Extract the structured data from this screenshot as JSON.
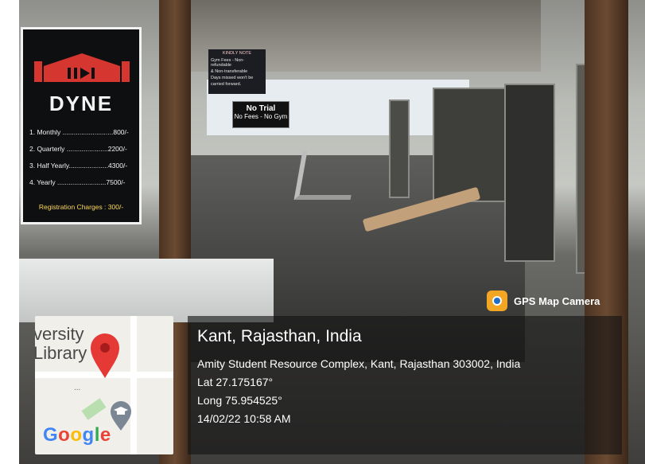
{
  "poster": {
    "brand": "DYNE",
    "plans": [
      "1. Monthly ...........................800/-",
      "2. Quarterly ......................2200/-",
      "3. Half Yearly.....................4300/-",
      "4. Yearly ..........................7500/-"
    ],
    "registration": "Registration Charges : 300/-"
  },
  "signs": {
    "kindly_title": "KINDLY NOTE",
    "kindly_line1": "Gym Fees - Non-refundable",
    "kindly_line2": "& Non-transferable",
    "kindly_line3": "Days missed won't be",
    "kindly_line4": "carried forward.",
    "no_trial": "No Trial",
    "no_fees": "No Fees - No Gym"
  },
  "gps_badge": {
    "label": "GPS Map Camera",
    "icon": "camera-pin-icon"
  },
  "map": {
    "text_line1": "versity",
    "text_line2": "Library",
    "dots": "...",
    "google_letters": [
      "G",
      "o",
      "o",
      "g",
      "l",
      "e"
    ],
    "google_colors": [
      "#4285F4",
      "#EA4335",
      "#FBBC05",
      "#4285F4",
      "#34A853",
      "#EA4335"
    ],
    "pin_color": "#e53935"
  },
  "location": {
    "place": "Kant, Rajasthan, India",
    "address": "Amity Student Resource Complex, Kant, Rajasthan 303002, India",
    "lat": "Lat 27.175167°",
    "long": "Long 75.954525°",
    "datetime": "14/02/22 10:58 AM"
  }
}
